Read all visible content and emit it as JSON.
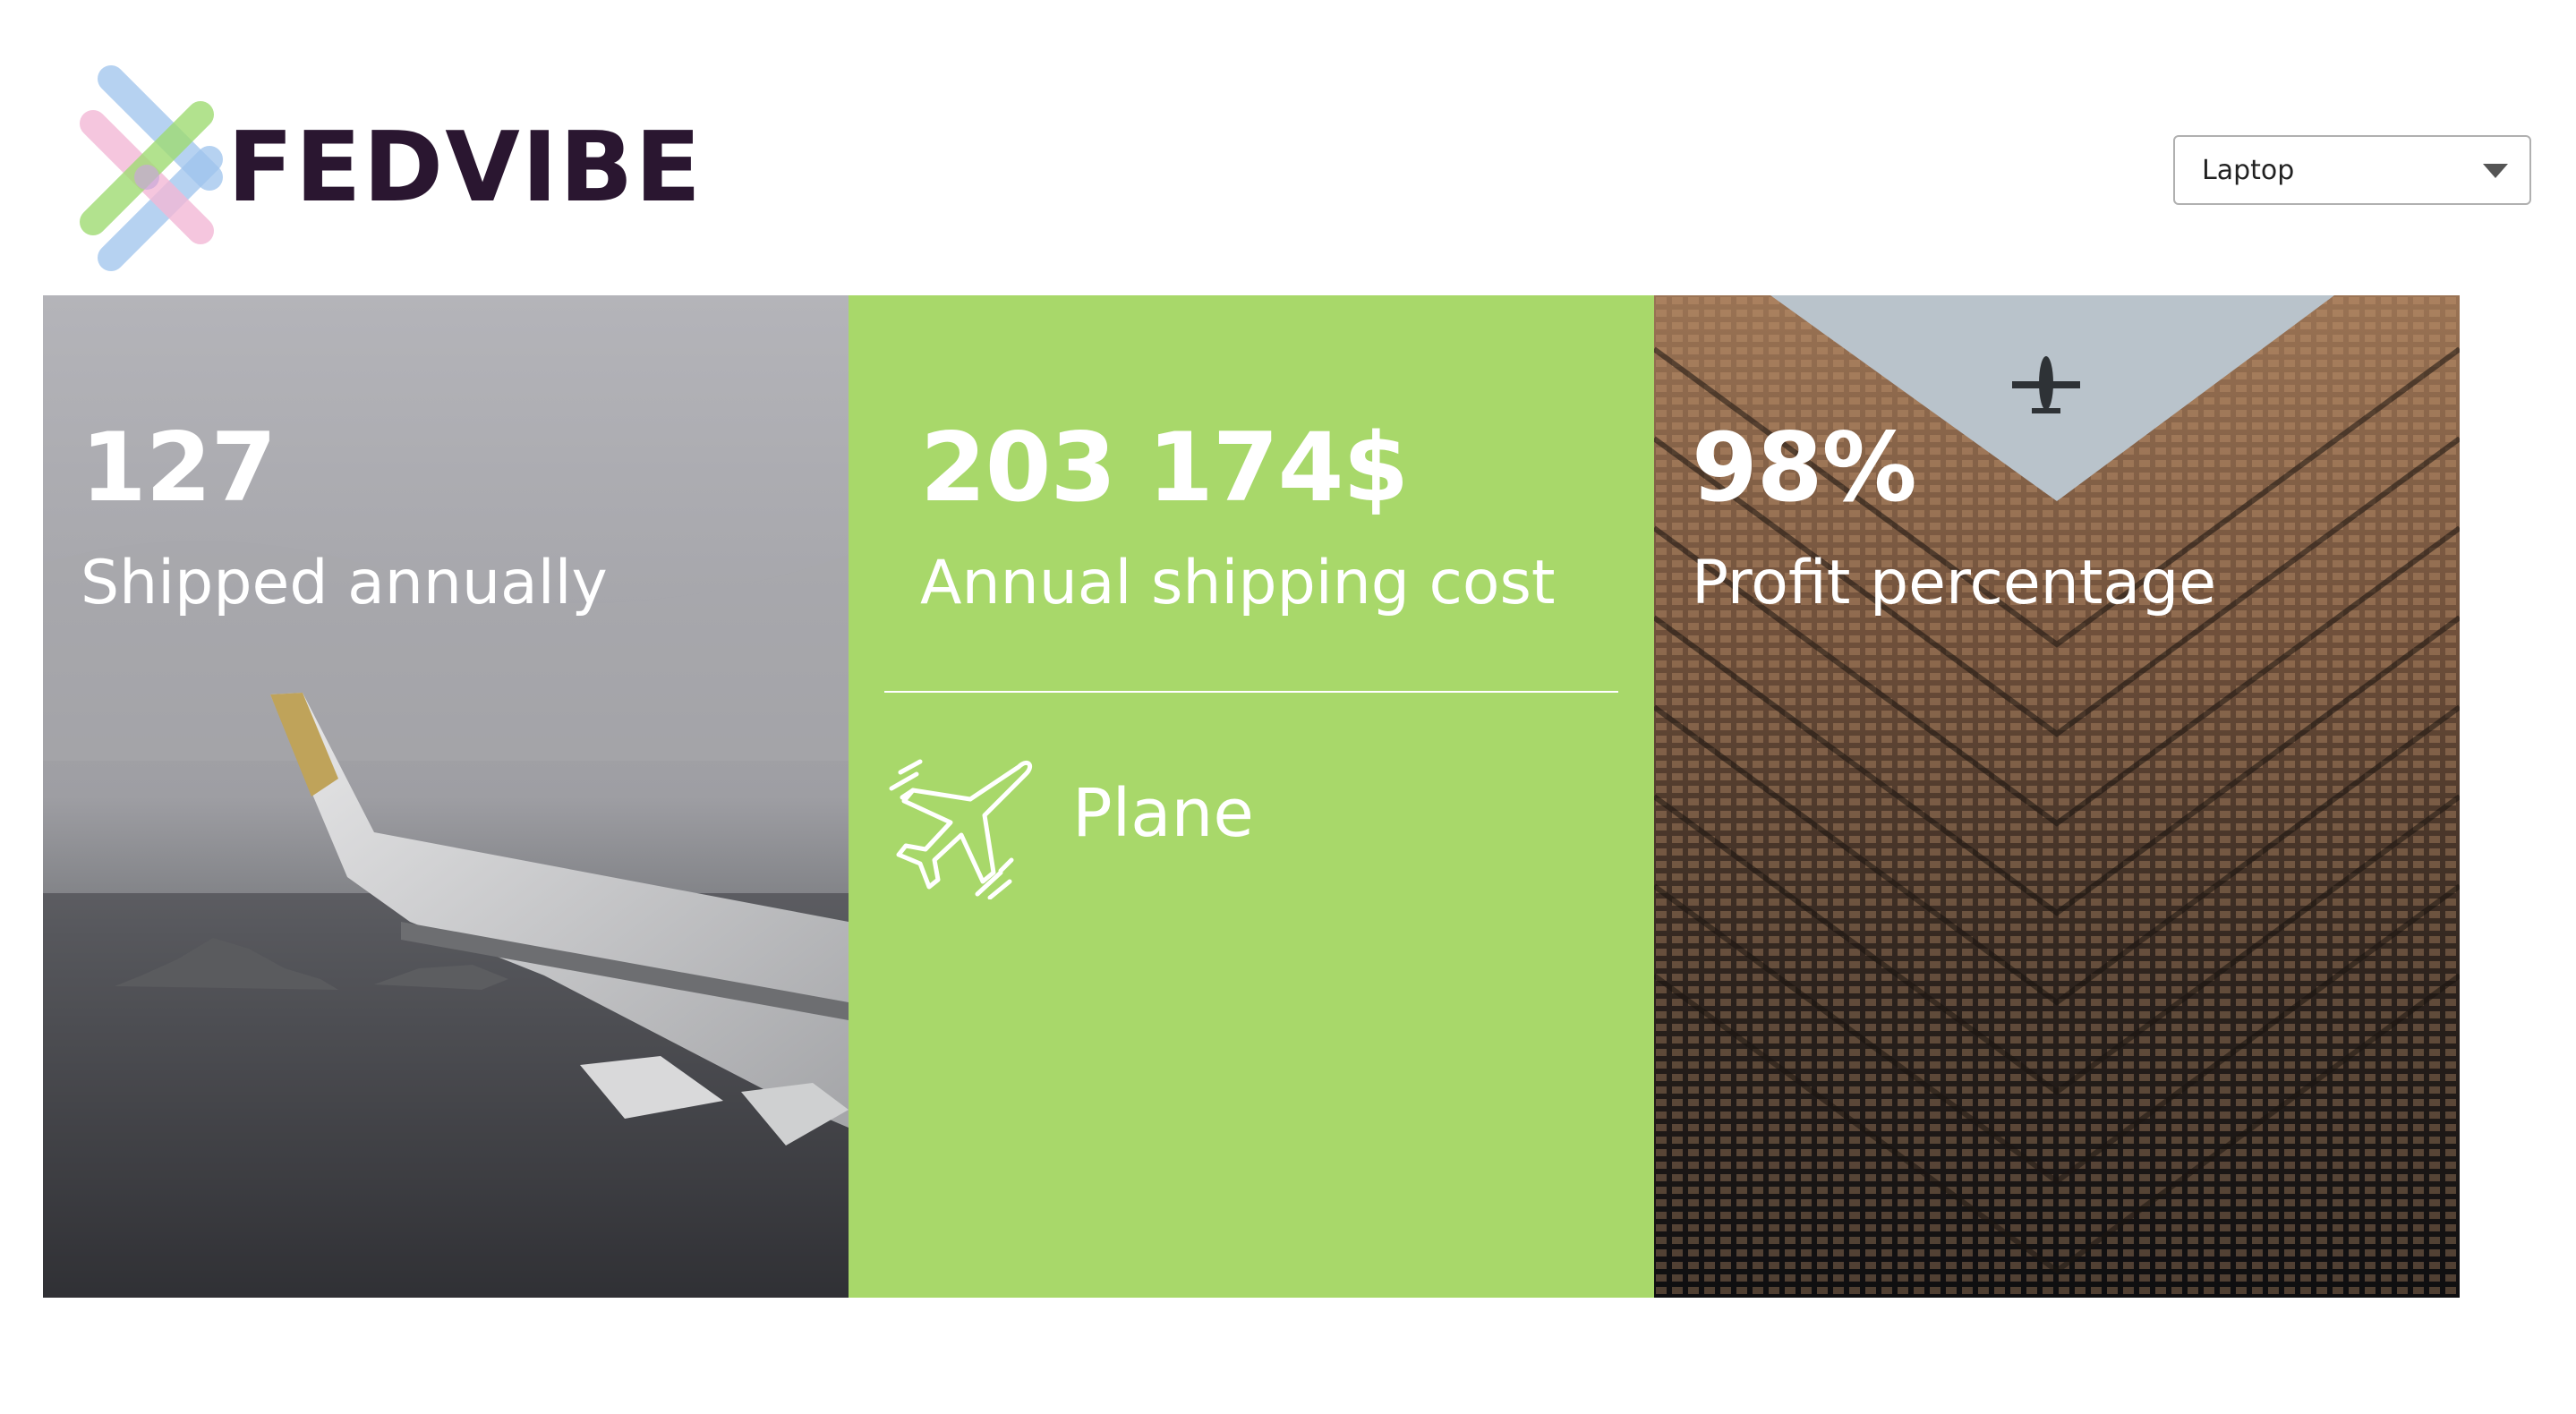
{
  "header": {
    "brand": "FEDVIBE",
    "logo_icon": "arrow-mark-logo",
    "select": {
      "value": "Laptop",
      "icon": "chevron-down-icon"
    }
  },
  "panels": [
    {
      "value": "127",
      "label": "Shipped annually",
      "background": "airplane-wing-over-sea-photo"
    },
    {
      "value": "203 174$",
      "label": "Annual shipping cost",
      "background_color": "#a8d86a",
      "transport": {
        "icon": "plane-icon",
        "label": "Plane"
      }
    },
    {
      "value": "98%",
      "label": "Profit percentage",
      "background": "building-facade-with-airplane-photo"
    }
  ],
  "colors": {
    "brand_text": "#2a1630",
    "accent_green": "#a8d86a"
  }
}
